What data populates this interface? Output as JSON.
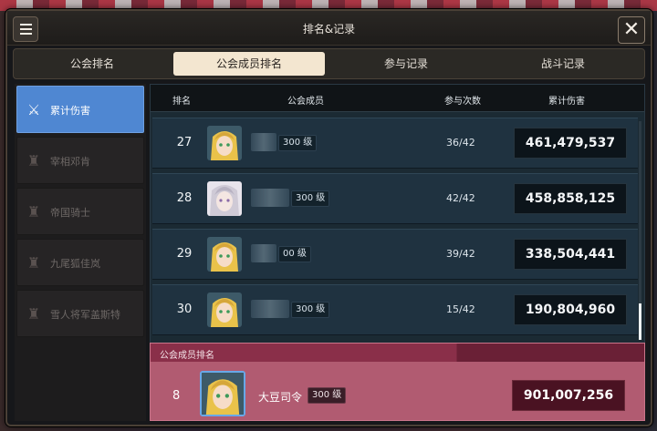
{
  "window": {
    "title": "排名&记录"
  },
  "tabs": [
    {
      "label": "公会排名"
    },
    {
      "label": "公会成员排名"
    },
    {
      "label": "参与记录"
    },
    {
      "label": "战斗记录"
    }
  ],
  "sidebar": {
    "items": [
      {
        "label": "累计伤害",
        "icon": "sword-icon"
      },
      {
        "label": "宰相邓肯",
        "icon": "boss-icon"
      },
      {
        "label": "帝国骑士",
        "icon": "boss-icon"
      },
      {
        "label": "九尾狐佳岚",
        "icon": "boss-icon"
      },
      {
        "label": "雪人将军盖斯特",
        "icon": "boss-icon"
      }
    ]
  },
  "table": {
    "headers": {
      "rank": "排名",
      "member": "公会成员",
      "count": "参与次数",
      "damage": "累计伤害"
    },
    "rows": [
      {
        "rank": "27",
        "level": "300 级",
        "count": "36/42",
        "damage": "461,479,537",
        "avatar": "blonde-hero"
      },
      {
        "rank": "28",
        "level": "300 级",
        "count": "42/42",
        "damage": "458,858,125",
        "avatar": "silver-hero"
      },
      {
        "rank": "29",
        "level": "00 级",
        "count": "39/42",
        "damage": "338,504,441",
        "avatar": "blonde-hero"
      },
      {
        "rank": "30",
        "level": "300 级",
        "count": "15/42",
        "damage": "190,804,960",
        "avatar": "blonde-hero"
      }
    ]
  },
  "my_rank": {
    "header": "公会成员排名",
    "rank": "8",
    "name": "大豆司令",
    "level": "300 级",
    "damage": "901,007,256"
  },
  "colors": {
    "active_tab": "#f3e6d0",
    "active_sidebar": "#4f87d2",
    "my_rank_bg": "#b15b71"
  }
}
